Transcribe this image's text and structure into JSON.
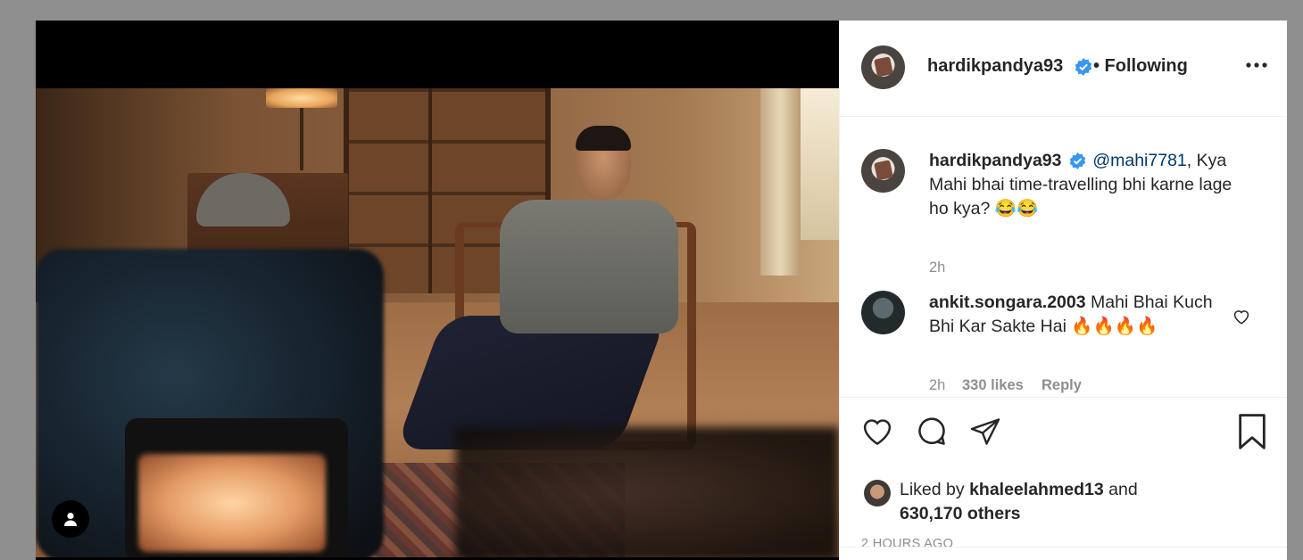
{
  "post": {
    "author": "hardikpandya93",
    "follow_state": "• Following",
    "more_icon": "more-horizontal-icon"
  },
  "caption": {
    "author": "hardikpandya93",
    "mention": "@mahi7781",
    "text": ", Kya Mahi bhai time-travelling bhi karne lage ho kya? 😂😂",
    "time": "2h"
  },
  "comments": [
    {
      "author": "ankit.songara.2003",
      "text": "Mahi Bhai Kuch Bhi Kar Sakte Hai 🔥🔥🔥🔥",
      "time": "2h",
      "likes": "330 likes",
      "reply": "Reply"
    }
  ],
  "liked_by": {
    "prefix": "Liked by",
    "user": "khaleelahmed13",
    "conj": "and",
    "others": "630,170 others"
  },
  "time_ago": "2 HOURS AGO",
  "colors": {
    "verified": "#3897f0",
    "text": "#262626",
    "muted": "#8e8e8e",
    "mention": "#00376b"
  }
}
